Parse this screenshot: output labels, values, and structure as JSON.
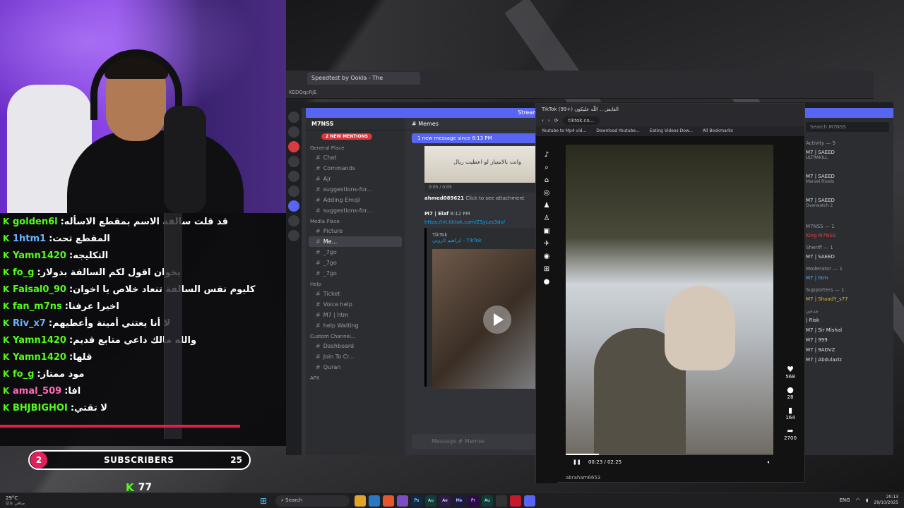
{
  "chat": {
    "messages": [
      {
        "user": "golden6l",
        "text": "قد قلت سالفة الاسم بمقطع الاسأله",
        "style": "green"
      },
      {
        "user": "1htm1",
        "text": "المقطع تحت",
        "style": "blue"
      },
      {
        "user": "Yamn1420",
        "text": "التكليجه",
        "style": "green"
      },
      {
        "user": "fo_g",
        "text": "يخوان اقول لكم السالفة بدولار",
        "style": "green"
      },
      {
        "user": "Faisal0_90",
        "text": "كليوم نفس السالفة تنعاد خلاص يا اخوان",
        "style": "green"
      },
      {
        "user": "fan_m7ns",
        "text": "اخيرا عرفنا",
        "style": "green"
      },
      {
        "user": "Riv_x7",
        "text": "لا أنا يعتني أمينة وأعطيهم",
        "style": "blue"
      },
      {
        "user": "Yamn1420",
        "text": "والله مالك داعي متابع قديم",
        "style": "green"
      },
      {
        "user": "Yamn1420",
        "text": "قلها",
        "style": "green"
      },
      {
        "user": "fo_g",
        "text": "مود ممتاز",
        "style": "green"
      },
      {
        "user": "amal_509",
        "text": "افا",
        "style": "pink"
      },
      {
        "user": "BHJBIGHOI",
        "text": "لا تقتي",
        "style": "green"
      }
    ]
  },
  "subs": {
    "circle": "2",
    "label": "SUBSCRIBERS",
    "count": "25"
  },
  "kick": {
    "count": "77"
  },
  "browser": {
    "tab_title": "Speedtest by Ookla - The",
    "url_fragment": "KEDOqcRjE"
  },
  "discord": {
    "stream_text": "Stream",
    "server_name": "M7NSS",
    "mentions": "2 NEW MENTIONS",
    "channels": [
      {
        "type": "cat",
        "label": "General Place"
      },
      {
        "type": "ch",
        "label": "Chat"
      },
      {
        "type": "ch",
        "label": "Commands"
      },
      {
        "type": "ch",
        "label": "Ajr"
      },
      {
        "type": "ch",
        "label": "suggestions-for..."
      },
      {
        "type": "ch",
        "label": "Adding Emoji"
      },
      {
        "type": "ch",
        "label": "suggestions-for..."
      },
      {
        "type": "cat",
        "label": "Media Place"
      },
      {
        "type": "ch",
        "label": "Picture"
      },
      {
        "type": "ch",
        "label": "Me...",
        "active": true
      },
      {
        "type": "ch",
        "label": "_7go"
      },
      {
        "type": "ch",
        "label": "_7go"
      },
      {
        "type": "ch",
        "label": "_7go"
      },
      {
        "type": "cat",
        "label": "Help"
      },
      {
        "type": "ch",
        "label": "Ticket"
      },
      {
        "type": "ch",
        "label": "Voice help"
      },
      {
        "type": "ch",
        "label": "M7 | htm"
      },
      {
        "type": "ch",
        "label": "help Waiting"
      },
      {
        "type": "cat",
        "label": "Custom Channel..."
      },
      {
        "type": "ch",
        "label": "Dashboard"
      },
      {
        "type": "ch",
        "label": "Join To Cr..."
      },
      {
        "type": "ch",
        "label": "Quran"
      },
      {
        "type": "cat",
        "label": "AFK"
      }
    ],
    "channel_header": "Memes",
    "new_message_bar": "1 new message since 8:13 PM",
    "image_caption": "وانت بالامتياز لو اعطيت ريال",
    "audio_time": "0:05 / 0:05",
    "reply_user": "ahmed089621",
    "reply_text": "Click to see attachment",
    "message_user": "M7 | Elaf",
    "message_time": "8:12 PM",
    "message_link": "https://vt.tiktok.com/ZSyLes3dv/",
    "embed_site": "TikTok",
    "embed_author": "ابراهيم الروبي - TikTok",
    "input_placeholder": "Message # Memes",
    "member_search": "Search M7NSS",
    "activity_header": "Activity — 5",
    "members": [
      {
        "name": "M7 | SAEED",
        "sub": "ULTRAKILL",
        "style": "activity"
      },
      {
        "name": "M7 | SAEED",
        "sub": "Marvel Rivals",
        "style": "activity"
      },
      {
        "name": "M7 | SAEED",
        "sub": "Overwatch 2",
        "style": "activity"
      },
      {
        "section": "M7NSS — 1"
      },
      {
        "name": "King M7NSS",
        "style": "red"
      },
      {
        "section": "Sheriff — 1"
      },
      {
        "name": "M7 | SAEED",
        "style": "plain"
      },
      {
        "section": "Moderator — 1"
      },
      {
        "name": "M7 | htm",
        "style": "blue"
      },
      {
        "section": "Supporters — 1"
      },
      {
        "name": "M7 | ShaadY_s77",
        "style": "gold"
      },
      {
        "section": "مدعي"
      },
      {
        "name": "| Risk",
        "style": "plain"
      },
      {
        "name": "M7 | Sir Mishal",
        "style": "plain"
      },
      {
        "name": "M7 | 999",
        "style": "plain"
      },
      {
        "name": "M7 | 9ADVZ",
        "style": "plain"
      },
      {
        "name": "M7 | Abdulaziz",
        "style": "plain"
      }
    ]
  },
  "tiktok": {
    "tab_title": "TikTok (القابض .. اللّه عليكون (+99",
    "url": "tiktok.co...",
    "bookmarks": [
      "Youtube to Mp4 vid...",
      "Download Youtube...",
      "Eating Videos Dow...",
      "All Bookmarks"
    ],
    "likes": "568",
    "comments": "28",
    "saves": "164",
    "shares": "2700",
    "time": "00:23 / 02:25",
    "progress": 0.16,
    "bottom_user": "abraham6653"
  },
  "taskbar": {
    "weather_temp": "29°C",
    "weather_desc": "صافي غالبًا",
    "search": "Search",
    "apps": [
      "Ps",
      "Au",
      "Ae",
      "Me",
      "Pr",
      "Au"
    ],
    "lang": "ENG",
    "time": "20:13",
    "date": "29/10/2025"
  }
}
